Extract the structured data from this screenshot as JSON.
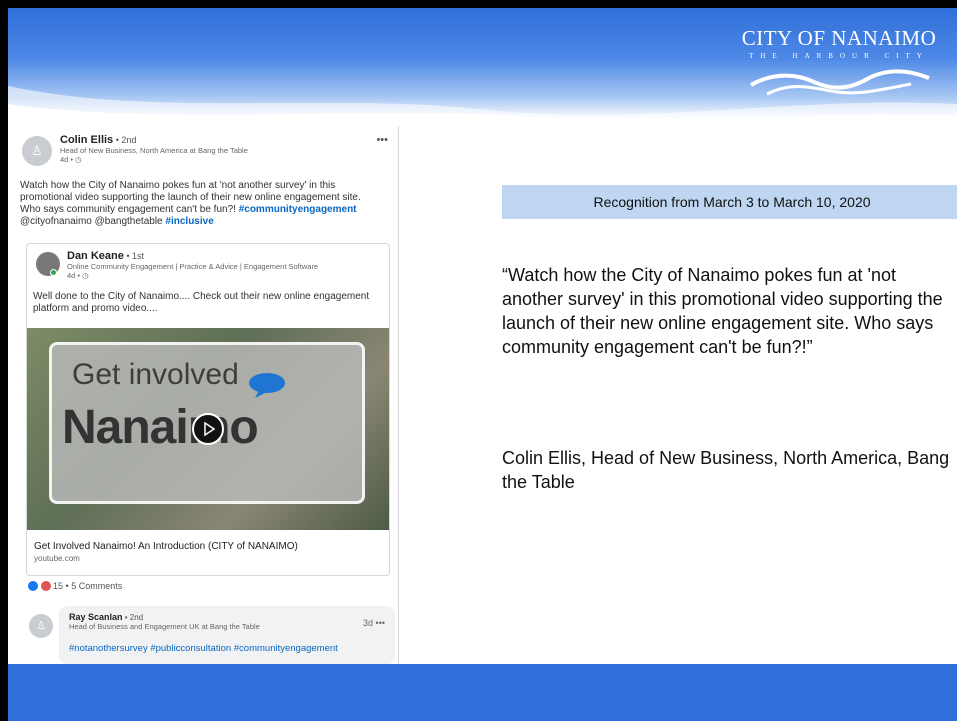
{
  "logo": {
    "title": "CITY OF NANAIMO",
    "subtitle": "THE HARBOUR CITY"
  },
  "post": {
    "author": "Colin Ellis",
    "degree": " • 2nd",
    "headline": "Head of New Business, North America at Bang the Table",
    "time": "4d • ◷",
    "more": "•••",
    "text": "Watch how the City of Nanaimo pokes fun at 'not another survey' in this promotional video supporting the launch of their new online engagement site. Who says community engagement can't be fun?!",
    "hashtag1": "#communityengagement",
    "mentions": "@cityofnanaimo @bangthetable",
    "hashtag2": "#inclusive",
    "shared": {
      "author": "Dan Keane",
      "degree": " • 1st",
      "headline": "Online Community Engagement | Practice & Advice | Engagement Software",
      "time": "4d • ◷",
      "text": "Well done to the City of Nanaimo.... Check out their new online engagement platform and promo video....",
      "video_line1": "Get involved",
      "video_line2": "Nanaimo",
      "link_title": "Get Involved Nanaimo! An Introduction (CITY of NANAIMO)",
      "link_source": "youtube.com"
    },
    "reactions": "15 • 5 Comments",
    "comment": {
      "author": "Ray Scanlan",
      "degree": " • 2nd",
      "headline": "Head of Business and Engagement UK at Bang the Table",
      "time": "3d",
      "more": "•••",
      "text": "#notanothersurvey #publicconsultation #communityengagement"
    }
  },
  "panel": {
    "heading": "Recognition from March 3 to March 10, 2020",
    "quote": "“Watch how the City of Nanaimo pokes fun at 'not another survey' in this promotional video supporting the launch of their new online engagement site. Who says community engagement can't be fun?!”",
    "attribution": "Colin Ellis, Head of New Business, North America, Bang the Table"
  },
  "colors": {
    "header_blue": "#2f6fd9",
    "panel_blue": "#bed6f1",
    "link_blue": "#0a66c2"
  }
}
